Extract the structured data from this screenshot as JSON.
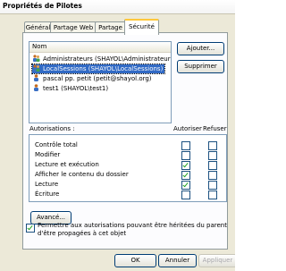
{
  "window": {
    "title": "Propriétés de Pilotes"
  },
  "tabs": [
    "Général",
    "Partage Web",
    "Partage",
    "Sécurité"
  ],
  "users": {
    "column_header": "Nom",
    "items": [
      {
        "label": "Administrateurs (SHAYOL\\Administrateurs)",
        "icon": "group-icon",
        "selected": false
      },
      {
        "label": "LocalSessions (SHAYOL\\LocalSessions)",
        "icon": "group-icon",
        "selected": true
      },
      {
        "label": "pascal pp. petit (petit@shayol.org)",
        "icon": "user-icon",
        "selected": false
      },
      {
        "label": "test1 (SHAYOL\\test1)",
        "icon": "user-icon",
        "selected": false
      }
    ],
    "add_label": "Ajouter...",
    "remove_label": "Supprimer"
  },
  "permissions": {
    "label": "Autorisations :",
    "allow_header": "Autoriser",
    "deny_header": "Refuser",
    "rows": [
      {
        "name": "Contrôle total",
        "allow": false,
        "deny": false
      },
      {
        "name": "Modifier",
        "allow": false,
        "deny": false
      },
      {
        "name": "Lecture et exécution",
        "allow": true,
        "deny": false
      },
      {
        "name": "Afficher le contenu du dossier",
        "allow": true,
        "deny": false
      },
      {
        "name": "Lecture",
        "allow": true,
        "deny": false
      },
      {
        "name": "Écriture",
        "allow": false,
        "deny": false
      }
    ]
  },
  "advanced_label": "Avancé...",
  "inherit": {
    "checked": true,
    "line1": "Permettre aux autorisations pouvant être héritées du parent",
    "line2": "d'être propagées à cet objet"
  },
  "buttons": {
    "ok": "OK",
    "cancel": "Annuler",
    "apply": "Appliquer"
  },
  "colors": {
    "selection": "#316AC5",
    "dialog_bg": "#ECE9D8",
    "active_tab_accent": "#FFC83C",
    "check": "#21A121"
  }
}
